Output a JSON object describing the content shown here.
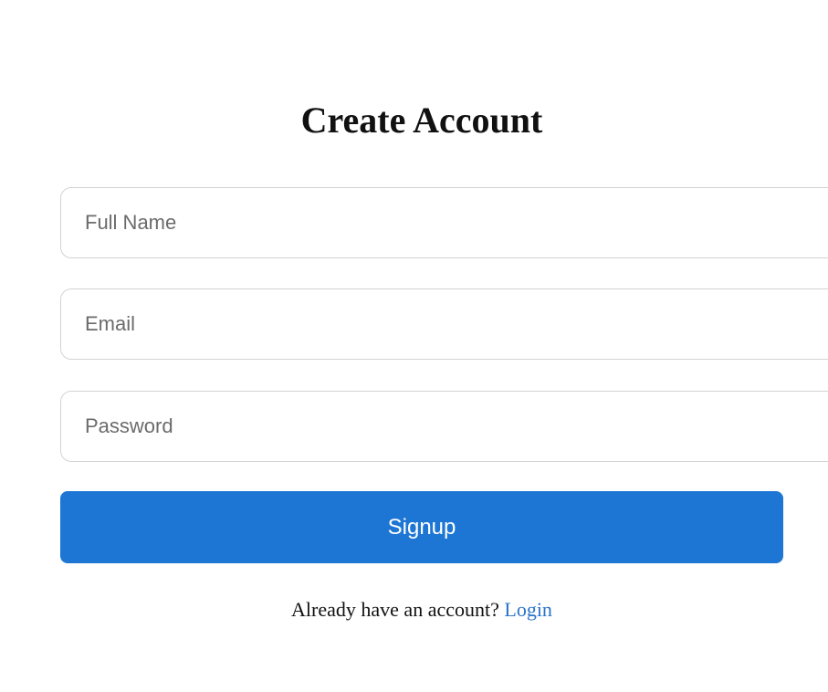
{
  "form": {
    "title": "Create Account",
    "fields": [
      {
        "placeholder": "Full Name",
        "value": ""
      },
      {
        "placeholder": "Email",
        "value": ""
      },
      {
        "placeholder": "Password",
        "value": ""
      }
    ],
    "signup_label": "Signup",
    "login_prompt": "Already have an account?",
    "login_link": "Login"
  },
  "colors": {
    "accent": "#1d76d3",
    "link": "#2a73c9",
    "border": "#d3d3d3",
    "text": "#111111",
    "placeholder": "#6b6b6b"
  }
}
